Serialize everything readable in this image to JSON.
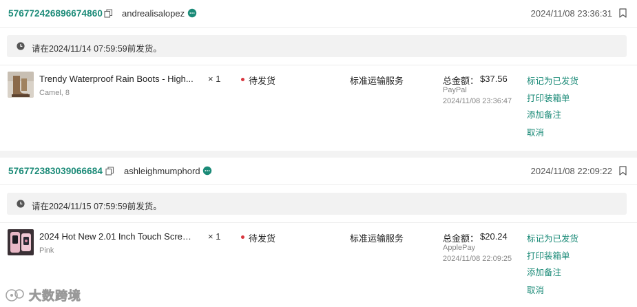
{
  "orders": [
    {
      "order_id": "576772426896674860",
      "buyer": "andrealisalopez",
      "order_time": "2024/11/08 23:36:31",
      "notice": "请在2024/11/14 07:59:59前发货。",
      "product_name": "Trendy Waterproof Rain Boots - High...",
      "variant": "Camel, 8",
      "quantity": "× 1",
      "status": "待发货",
      "shipping": "标准运输服务",
      "total_label": "总金额：",
      "total_value": "$37.56",
      "payment_method": "PayPal",
      "payment_time": "2024/11/08 23:36:47",
      "actions": [
        "标记为已发货",
        "打印装箱单",
        "添加备注",
        "取消"
      ]
    },
    {
      "order_id": "576772383039066684",
      "buyer": "ashleighmumphord",
      "order_time": "2024/11/08 22:09:22",
      "notice": "请在2024/11/15 07:59:59前发货。",
      "product_name": "2024 Hot New 2.01 Inch Touch Screen...",
      "variant": "Pink",
      "quantity": "× 1",
      "status": "待发货",
      "shipping": "标准运输服务",
      "total_label": "总金额：",
      "total_value": "$20.24",
      "payment_method": "ApplePay",
      "payment_time": "2024/11/08 22:09:25",
      "actions": [
        "标记为已发货",
        "打印装箱单",
        "添加备注",
        "取消"
      ]
    }
  ],
  "watermark": "大数跨境",
  "colors": {
    "accent": "#1a8a77",
    "status_dot": "#d9363e",
    "notice_bg": "#f2f2f2",
    "separator_bg": "#f3f3f3"
  },
  "icons": [
    "copy-icon",
    "chat-icon",
    "bookmark-icon",
    "clock-icon"
  ]
}
